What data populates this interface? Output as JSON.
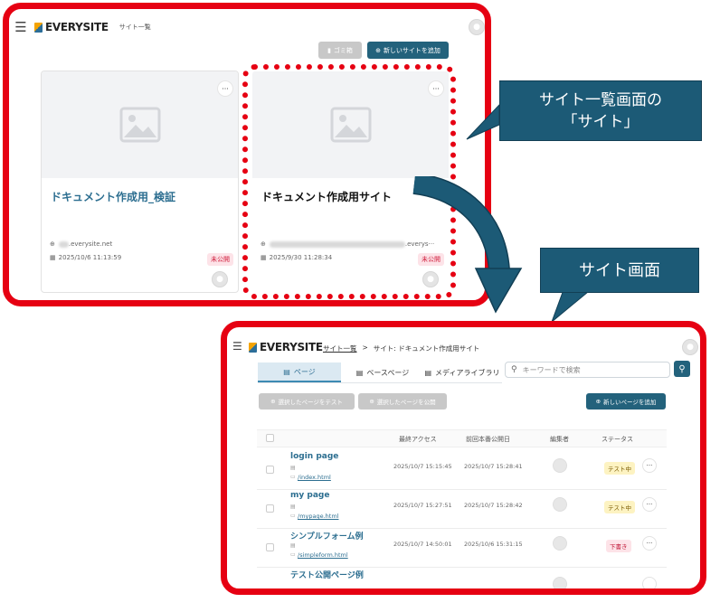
{
  "panel1": {
    "logo_text": "EVERYSITE",
    "breadcrumb": "サイト一覧",
    "trash_label": "ゴミ箱",
    "add_site_label": "新しいサイトを追加",
    "cards": [
      {
        "title": "ドキュメント作成用_検証",
        "domain_suffix": ".everysite.net",
        "date": "2025/10/6 11:13:59",
        "status": "未公開",
        "more": "···"
      },
      {
        "title": "ドキュメント作成用サイト",
        "domain_suffix": ".everys···",
        "date": "2025/9/30 11:28:34",
        "status": "未公開",
        "more": "···"
      }
    ]
  },
  "callouts": {
    "site_list": [
      "サイト一覧画面の",
      "「サイト」"
    ],
    "site_screen": "サイト画面"
  },
  "panel2": {
    "logo_text": "EVERYSITE",
    "breadcrumb_link": "サイト一覧",
    "breadcrumb_sep": ">",
    "breadcrumb_current": "サイト: ドキュメント作成用サイト",
    "tabs": [
      {
        "icon": "page-icon",
        "label": "ページ",
        "active": true
      },
      {
        "icon": "base-page-icon",
        "label": "ベースページ",
        "active": false
      },
      {
        "icon": "media-library-icon",
        "label": "メディアライブラリ",
        "active": false
      }
    ],
    "search_placeholder": "キーワードで検索",
    "test_selected_label": "選択したページをテスト",
    "publish_selected_label": "選択したページを公開",
    "add_page_label": "新しいページを追加",
    "columns": [
      "最終アクセス",
      "前回本番公開日",
      "編集者",
      "ステータス"
    ],
    "rows": [
      {
        "name": "login page",
        "url": "/index.html",
        "last_access": "2025/10/7 15:15:45",
        "last_publish": "2025/10/7 15:28:41",
        "status": "テスト中",
        "status_color": "#fdf3c2"
      },
      {
        "name": "my page",
        "url": "/mypage.html",
        "last_access": "2025/10/7 15:27:51",
        "last_publish": "2025/10/7 15:28:42",
        "status": "テスト中",
        "status_color": "#fdf3c2"
      },
      {
        "name": "シンプルフォーム例",
        "url": "/simpleform.html",
        "last_access": "2025/10/7 14:50:01",
        "last_publish": "2025/10/6 15:31:15",
        "status": "下書き",
        "status_color": "#fde3e8"
      },
      {
        "name": "テスト公開ページ例",
        "url": "",
        "last_access": "",
        "last_publish": "",
        "status": "",
        "status_color": "#fdf3c2"
      }
    ],
    "more": "···"
  },
  "colors": {
    "highlight_red": "#e60012",
    "callout_bg": "#1c5a76",
    "accent_teal": "#23627c",
    "link_blue": "#2c6e90"
  }
}
